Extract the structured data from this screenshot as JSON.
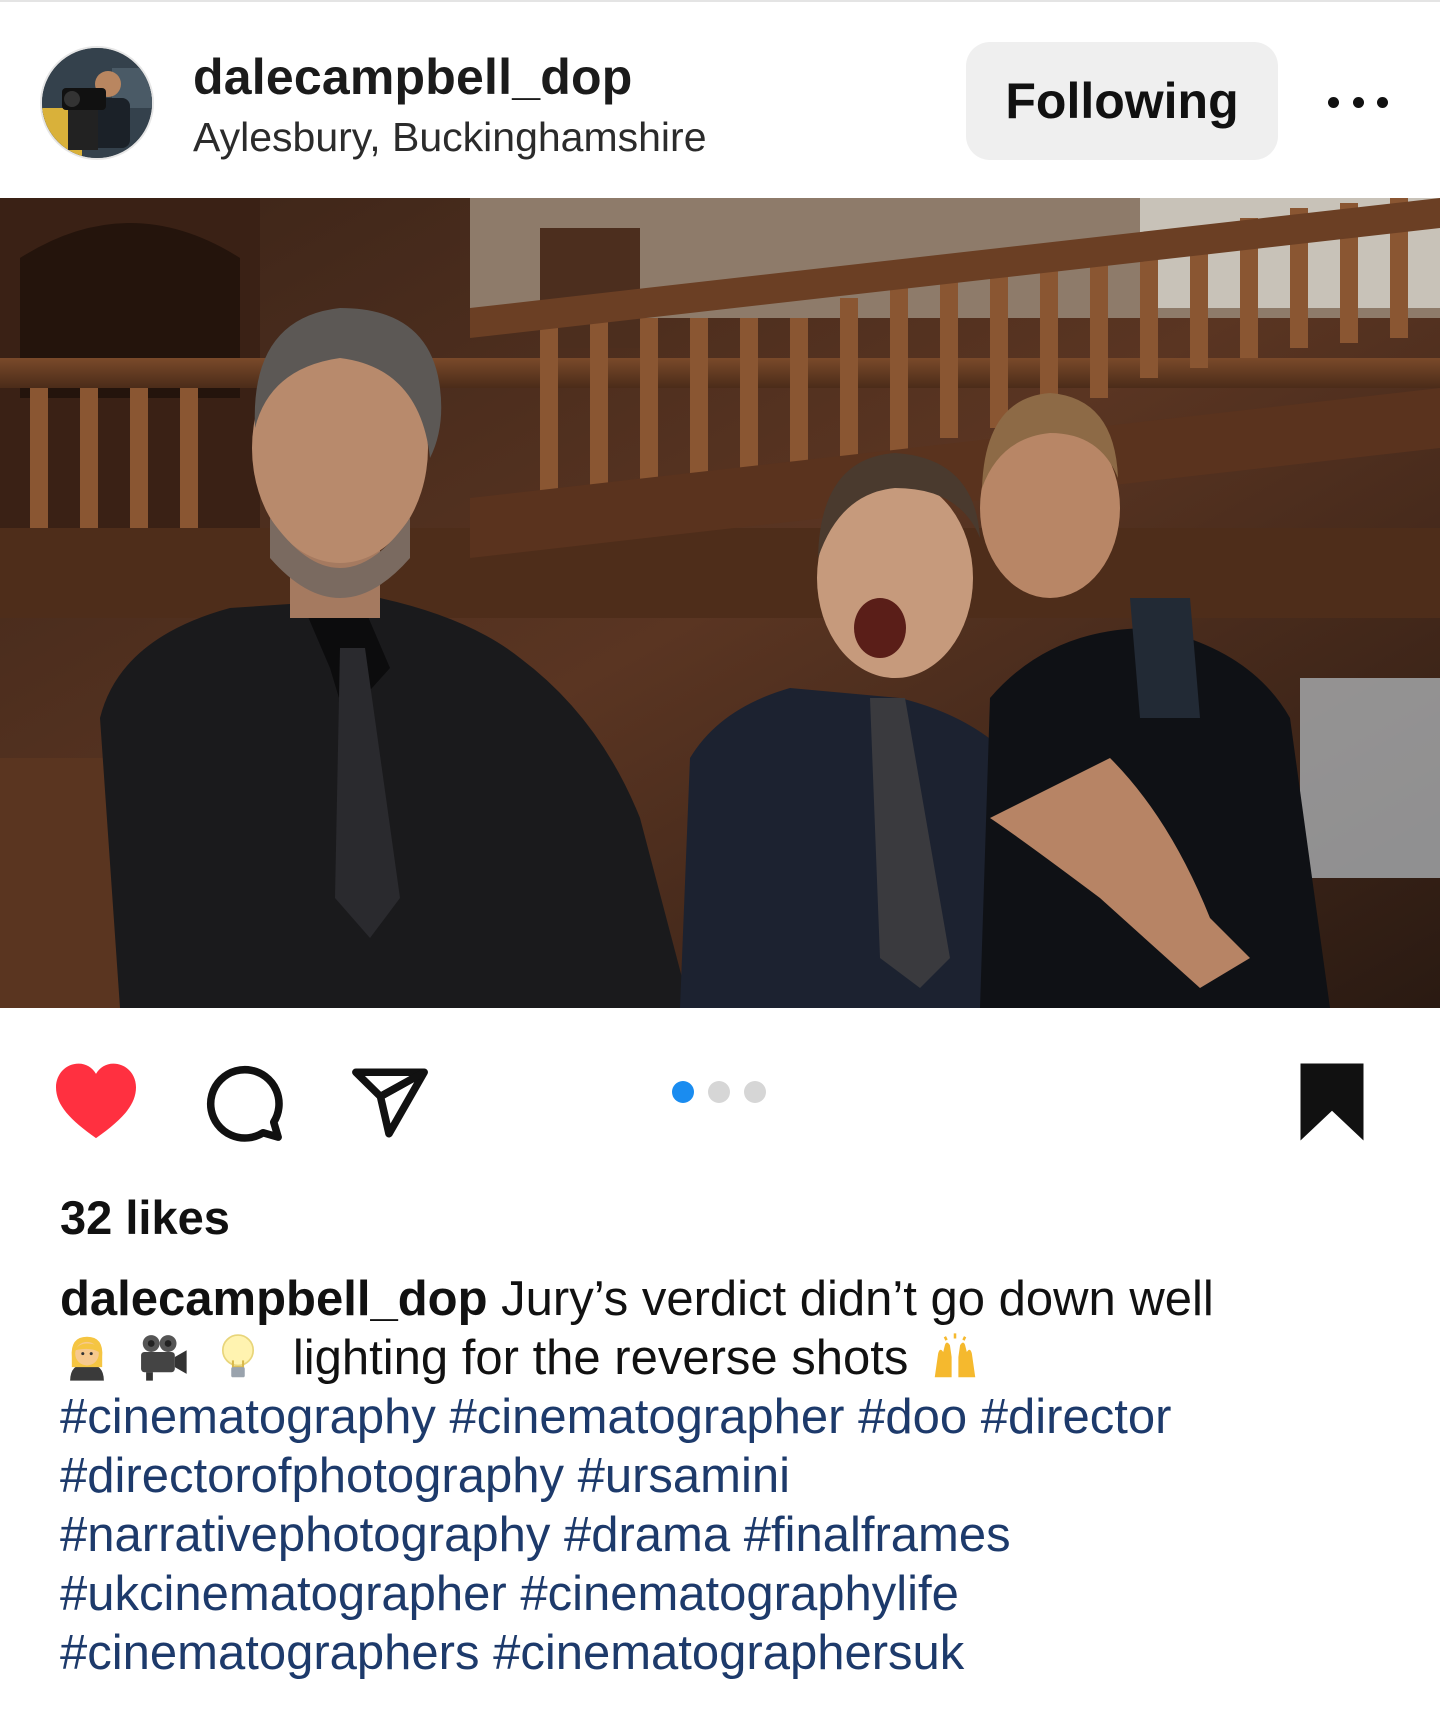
{
  "post": {
    "username": "dalecampbell_dop",
    "location": "Aylesbury, Buckinghamshire",
    "follow_label": "Following",
    "more_icon": "more-horizontal-icon",
    "likes_text": "32 likes",
    "liked": true,
    "saved": true,
    "carousel": {
      "count": 3,
      "active_index": 0
    },
    "caption": {
      "username": "dalecampbell_dop",
      "text_line1": "Jury’s verdict didn’t go down well",
      "text_line2": "lighting for the reverse shots",
      "hashtags": [
        [
          "#cinematography",
          "#cinematographer",
          "#doo",
          "#director"
        ],
        [
          "#directorofphotography",
          "#ursamini"
        ],
        [
          "#narrativephotography",
          "#drama",
          "#finalframes"
        ],
        [
          "#ukcinematographer",
          "#cinematographylife"
        ],
        [
          "#cinematographers",
          "#cinematographersuk"
        ]
      ]
    },
    "icons": [
      "heart-icon",
      "comment-icon",
      "share-icon",
      "bookmark-icon"
    ],
    "colors": {
      "like_red": "#ff3040",
      "active_dot": "#1a8cf0",
      "hashtag": "#1d3a6b",
      "button_bg": "#efefef"
    }
  }
}
